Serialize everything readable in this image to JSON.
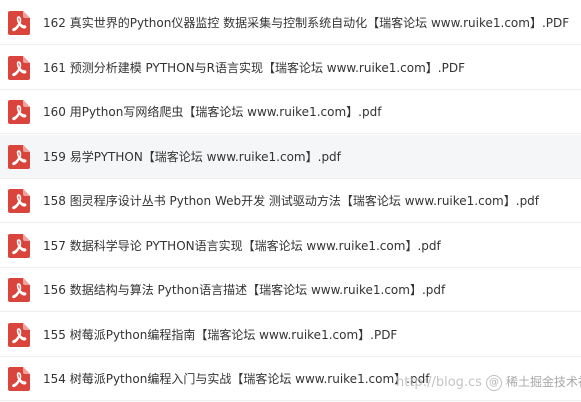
{
  "colors": {
    "pdf_icon_red": "#d9453d",
    "row_highlight": "#f5f6f7",
    "text": "#333333"
  },
  "files": [
    {
      "name": "162 真实世界的Python仪器监控 数据采集与控制系统自动化【瑞客论坛 www.ruike1.com】.PDF",
      "icon": "pdf-icon",
      "highlighted": false
    },
    {
      "name": "161 预测分析建模 PYTHON与R语言实现【瑞客论坛 www.ruike1.com】.PDF",
      "icon": "pdf-icon",
      "highlighted": false
    },
    {
      "name": "160 用Python写网络爬虫【瑞客论坛 www.ruike1.com】.pdf",
      "icon": "pdf-icon",
      "highlighted": false
    },
    {
      "name": "159 易学PYTHON【瑞客论坛 www.ruike1.com】.pdf",
      "icon": "pdf-icon",
      "highlighted": true
    },
    {
      "name": "158 图灵程序设计丛书 Python Web开发 测试驱动方法【瑞客论坛 www.ruike1.com】.pdf",
      "icon": "pdf-icon",
      "highlighted": false
    },
    {
      "name": "157 数据科学导论 PYTHON语言实现【瑞客论坛 www.ruike1.com】.pdf",
      "icon": "pdf-icon",
      "highlighted": false
    },
    {
      "name": "156 数据结构与算法 Python语言描述【瑞客论坛 www.ruike1.com】.pdf",
      "icon": "pdf-icon",
      "highlighted": false
    },
    {
      "name": "155 树莓派Python编程指南【瑞客论坛 www.ruike1.com】.PDF",
      "icon": "pdf-icon",
      "highlighted": false
    },
    {
      "name": "154 树莓派Python编程入门与实战【瑞客论坛 www.ruike1.com】.pdf",
      "icon": "pdf-icon",
      "highlighted": false
    }
  ],
  "watermark": {
    "text": "http://blog.cs",
    "brand": "稀土掘金技术社区"
  }
}
